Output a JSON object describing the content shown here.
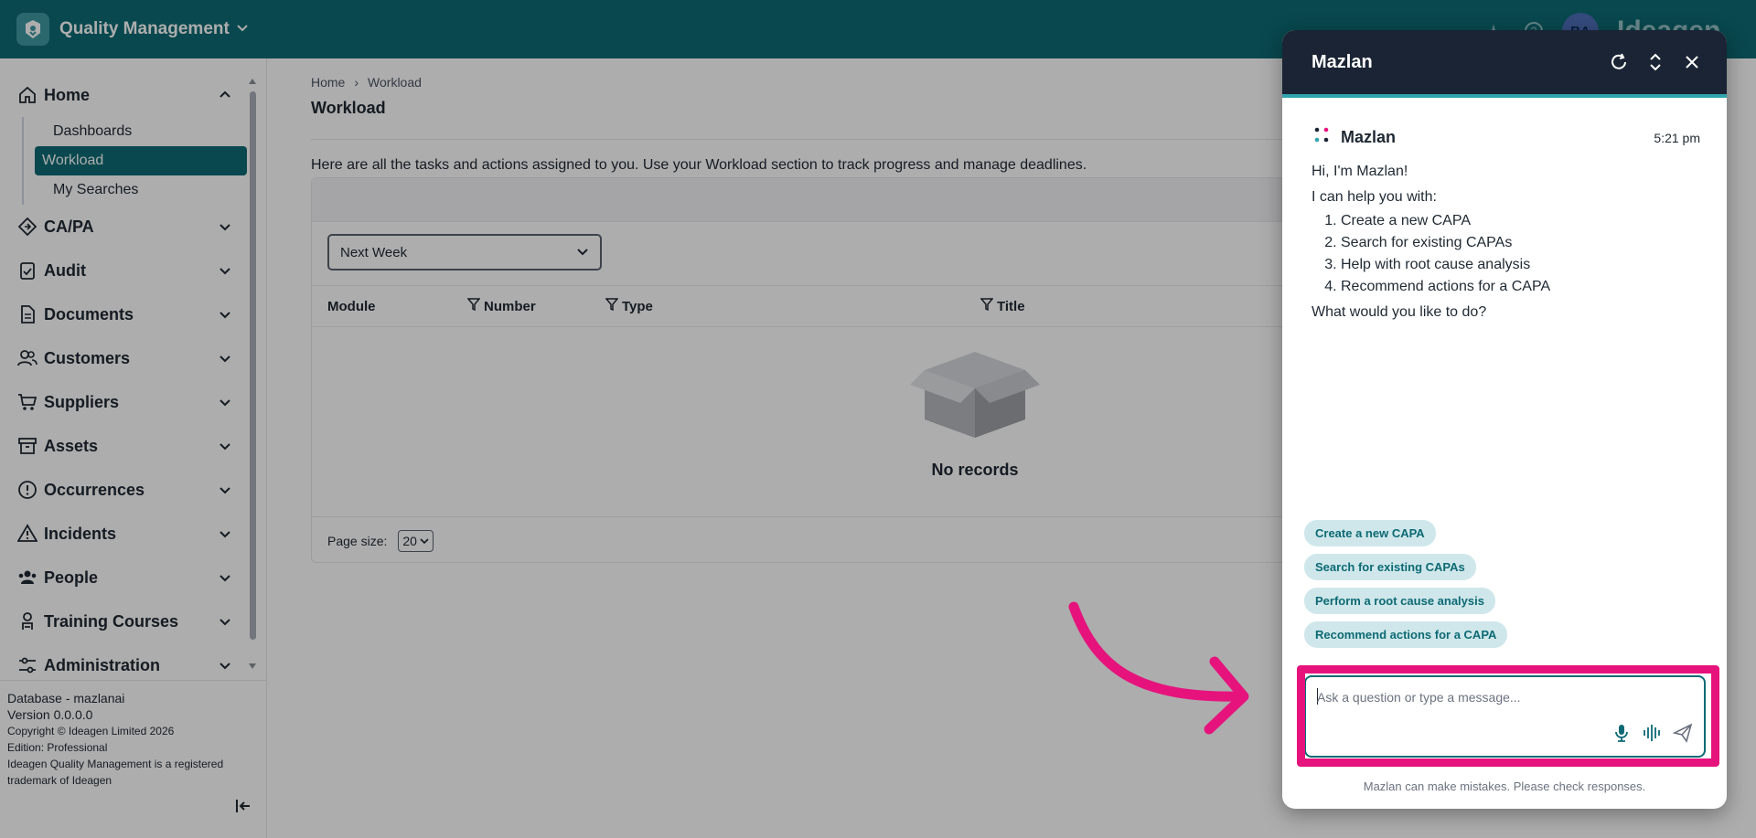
{
  "app": {
    "title": "Quality Management",
    "avatar_initials": "BA",
    "brand": "Ideagen"
  },
  "sidebar": {
    "items": [
      {
        "label": "Home",
        "icon": "home-icon",
        "sub": [
          "Dashboards",
          "Workload",
          "My Searches"
        ],
        "active_sub": "Workload"
      },
      {
        "label": "CA/PA",
        "icon": "capa-icon"
      },
      {
        "label": "Audit",
        "icon": "audit-icon"
      },
      {
        "label": "Documents",
        "icon": "document-icon"
      },
      {
        "label": "Customers",
        "icon": "customers-icon"
      },
      {
        "label": "Suppliers",
        "icon": "cart-icon"
      },
      {
        "label": "Assets",
        "icon": "archive-icon"
      },
      {
        "label": "Occurrences",
        "icon": "alert-circle-icon"
      },
      {
        "label": "Incidents",
        "icon": "warning-icon"
      },
      {
        "label": "People",
        "icon": "people-icon"
      },
      {
        "label": "Training Courses",
        "icon": "training-icon"
      },
      {
        "label": "Administration",
        "icon": "sliders-icon"
      }
    ],
    "footer": {
      "database": "Database - mazlanai",
      "version": "Version 0.0.0.0",
      "copyright": "Copyright © Ideagen Limited 2026",
      "edition": "Edition: Professional",
      "trademark_1": "Ideagen Quality Management is a registered",
      "trademark_2": "trademark of Ideagen"
    }
  },
  "main": {
    "breadcrumb": [
      "Home",
      "Workload"
    ],
    "title": "Workload",
    "intro": "Here are all the tasks and actions assigned to you. Use your Workload section to track progress and manage deadlines.",
    "period_filter": "Next Week",
    "columns": [
      "Module",
      "Number",
      "Type",
      "Title"
    ],
    "empty_text": "No records",
    "page_size_label": "Page size:",
    "page_size": "20"
  },
  "chat": {
    "title": "Mazlan",
    "sender": "Mazlan",
    "time": "5:21 pm",
    "greeting": "Hi, I'm Mazlan!",
    "help_intro": "I can help you with:",
    "options": [
      "Create a new CAPA",
      "Search for existing CAPAs",
      "Help with root cause analysis",
      "Recommend actions for a CAPA"
    ],
    "question": "What would you like to do?",
    "suggestions": [
      "Create a new CAPA",
      "Search for existing CAPAs",
      "Perform a root cause analysis",
      "Recommend actions for a CAPA"
    ],
    "input_placeholder": "Ask a question or type a message...",
    "disclaimer": "Mazlan can make mistakes. Please check responses."
  },
  "colors": {
    "brand": "#0c6a74",
    "highlight": "#e6137d",
    "chat_header": "#1b2434"
  }
}
